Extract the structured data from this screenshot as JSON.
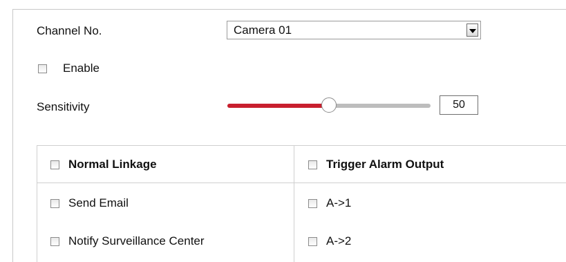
{
  "channel": {
    "label": "Channel No.",
    "selected": "Camera 01"
  },
  "enable": {
    "label": "Enable",
    "checked": false
  },
  "sensitivity": {
    "label": "Sensitivity",
    "value": "50",
    "level": 50,
    "max": 100
  },
  "linkage": {
    "normal": {
      "header": "Normal Linkage",
      "items": [
        {
          "label": "Send Email",
          "checked": false
        },
        {
          "label": "Notify Surveillance Center",
          "checked": false
        }
      ]
    },
    "alarm_output": {
      "header": "Trigger Alarm Output",
      "items": [
        {
          "label": "A->1",
          "checked": false
        },
        {
          "label": "A->2",
          "checked": false
        }
      ]
    }
  },
  "colors": {
    "slider_fill": "#c81f2e",
    "slider_track": "#bdbdbd",
    "border": "#cfcfcf"
  }
}
